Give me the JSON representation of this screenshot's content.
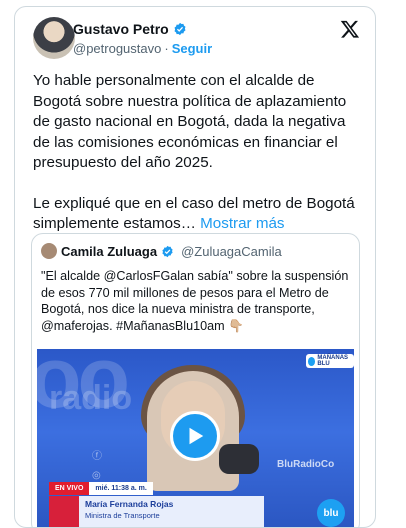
{
  "author": {
    "name": "Gustavo Petro",
    "handle": "@petrogustavo",
    "separator": "·",
    "follow_label": "Seguir"
  },
  "icons": {
    "verified": "verified-badge-icon",
    "platform": "x-logo-icon",
    "play": "play-icon"
  },
  "tweet": {
    "paragraph1": "Yo hable personalmente con el alcalde  de Bogotá sobre nuestra política de aplazamiento de gasto nacional en Bogotá, dada la negativa de las comisiones económicas en financiar el presupuesto del año 2025.",
    "paragraph2": "Le expliqué que en el caso del metro de Bogotá simplemente estamos…",
    "show_more": "Mostrar más"
  },
  "quote": {
    "name": "Camila Zuluaga",
    "handle": "@ZuluagaCamila",
    "text": "\"El alcalde @CarlosFGalan sabía\" sobre la suspensión de esos 770 mil millones de pesos para el Metro de Bogotá, nos dice la nueva ministra de transporte, @maferojas. #MañanasBlu10am 👇🏼"
  },
  "video": {
    "live_label": "EN VIVO",
    "time": "mié. 11:38 a. m.",
    "guest_name": "María Fernanda Rojas",
    "guest_title": "Ministra de Transporte",
    "brand_handle": "BluRadioCo",
    "logo_text": "blu",
    "badge_text": "MAÑANAS BLU",
    "background_word": "radio"
  },
  "colors": {
    "accent": "#1d9bf0",
    "text": "#0f1419",
    "secondary_text": "#536471",
    "border": "#cfd9de",
    "live_red": "#e11d2e"
  }
}
